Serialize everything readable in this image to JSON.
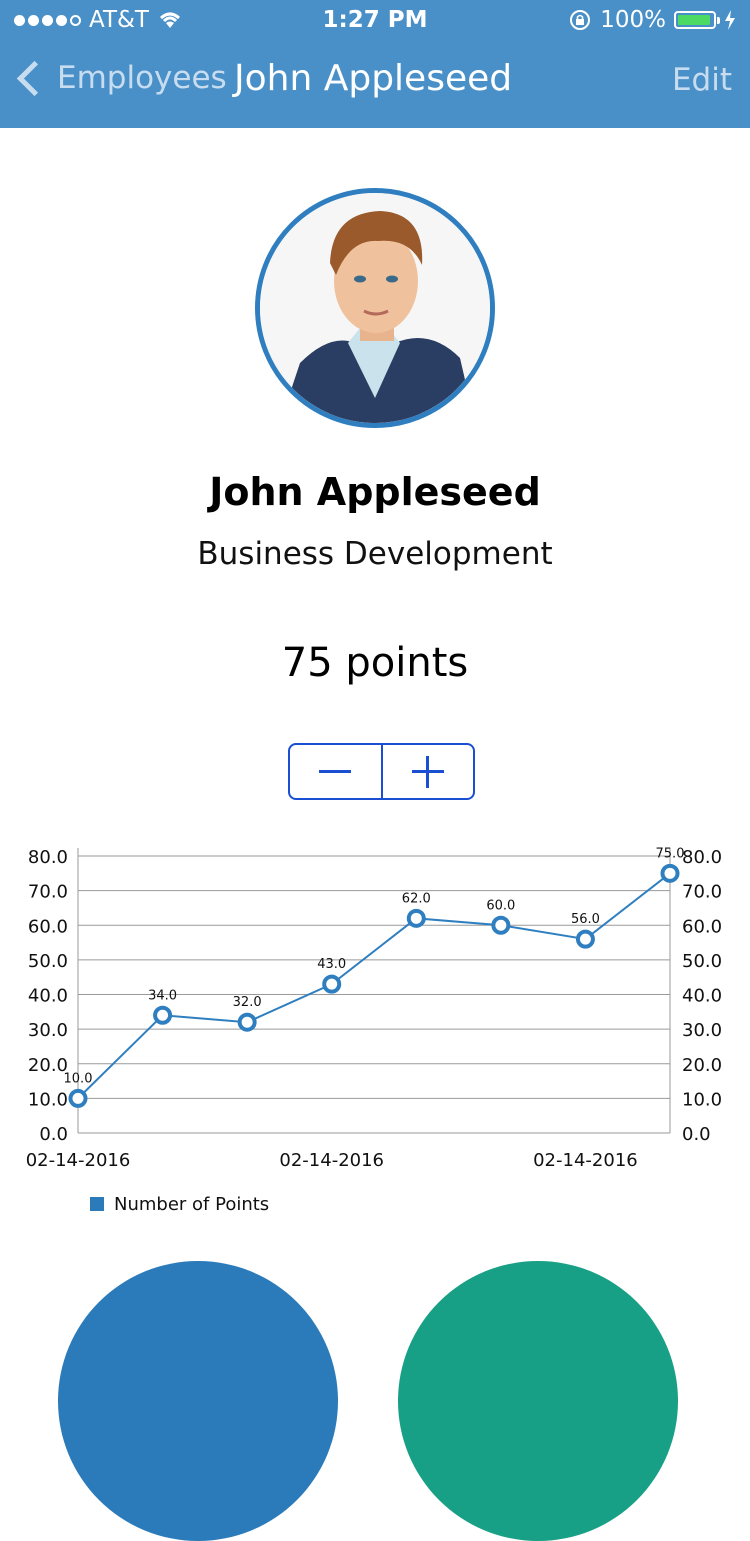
{
  "status_bar": {
    "carrier": "AT&T",
    "time": "1:27 PM",
    "battery_text": "100%"
  },
  "nav": {
    "back_label": "Employees",
    "title": "John Appleseed",
    "edit_label": "Edit"
  },
  "profile": {
    "name": "John Appleseed",
    "department": "Business Development",
    "points_text": "75 points"
  },
  "stepper": {
    "minus_icon": "minus-icon",
    "plus_icon": "plus-icon"
  },
  "colors": {
    "nav_background": "#4a90c8",
    "accent_blue": "#2b7bba",
    "stepper_blue": "#1a4fd1",
    "teal": "#17a085",
    "line": "#2f7fc0"
  },
  "chart_data": {
    "type": "line",
    "x_labels": [
      "02-14-2016",
      "02-14-2016",
      "02-14-2016"
    ],
    "series": [
      {
        "name": "Number of Points",
        "values": [
          10.0,
          34.0,
          32.0,
          43.0,
          62.0,
          60.0,
          56.0,
          75.0
        ],
        "data_labels": [
          "10.0",
          "34.0",
          "32.0",
          "43.0",
          "62.0",
          "60.0",
          "56.0",
          "75.0"
        ]
      }
    ],
    "y_ticks": [
      "0.0",
      "10.0",
      "20.0",
      "30.0",
      "40.0",
      "50.0",
      "60.0",
      "70.0",
      "80.0"
    ],
    "ylim": [
      0,
      80
    ],
    "grid": true,
    "legend_position": "bottom-left"
  }
}
